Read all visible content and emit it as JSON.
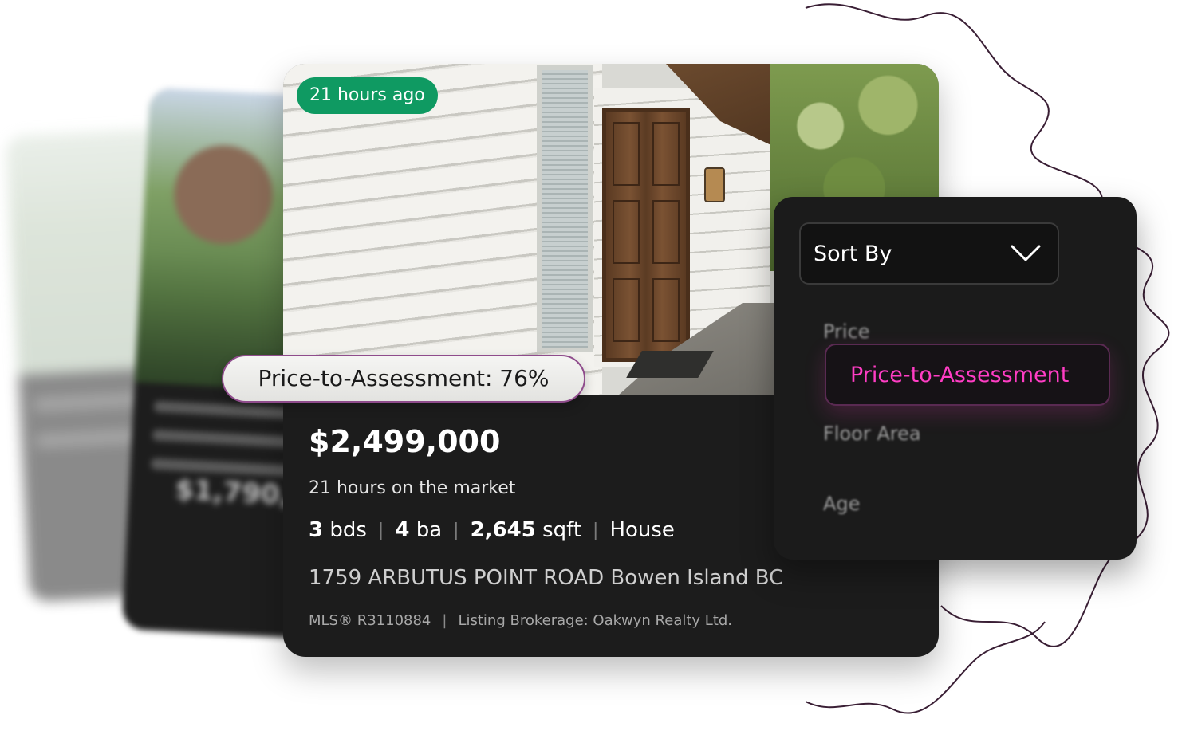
{
  "main_listing": {
    "time_badge": "21 hours ago",
    "price_to_assessment": "Price-to-Assessment: 76%",
    "price": "$2,499,000",
    "time_on_market": "21 hours on the market",
    "beds": "3",
    "beds_unit": "bds",
    "baths": "4",
    "baths_unit": "ba",
    "sqft": "2,645",
    "sqft_unit": "sqft",
    "type": "House",
    "address": "1759 ARBUTUS POINT ROAD Bowen Island BC",
    "mls": "MLS® R3110884",
    "brokerage": "Listing Brokerage: Oakwyn Realty Ltd."
  },
  "background_listing": {
    "price_partial": "$1,790,0"
  },
  "sort_menu": {
    "label": "Sort By",
    "options": [
      {
        "label": "Price",
        "selected": false
      },
      {
        "label": "Price-to-Assessment",
        "selected": true
      },
      {
        "label": "Floor Area",
        "selected": false
      },
      {
        "label": "Age",
        "selected": false
      }
    ],
    "accent_color": "#ff3dc4"
  },
  "colors": {
    "badge_green": "#0f9a62",
    "card_dark": "#1c1c1c",
    "pill_border": "#8f4c8c"
  }
}
